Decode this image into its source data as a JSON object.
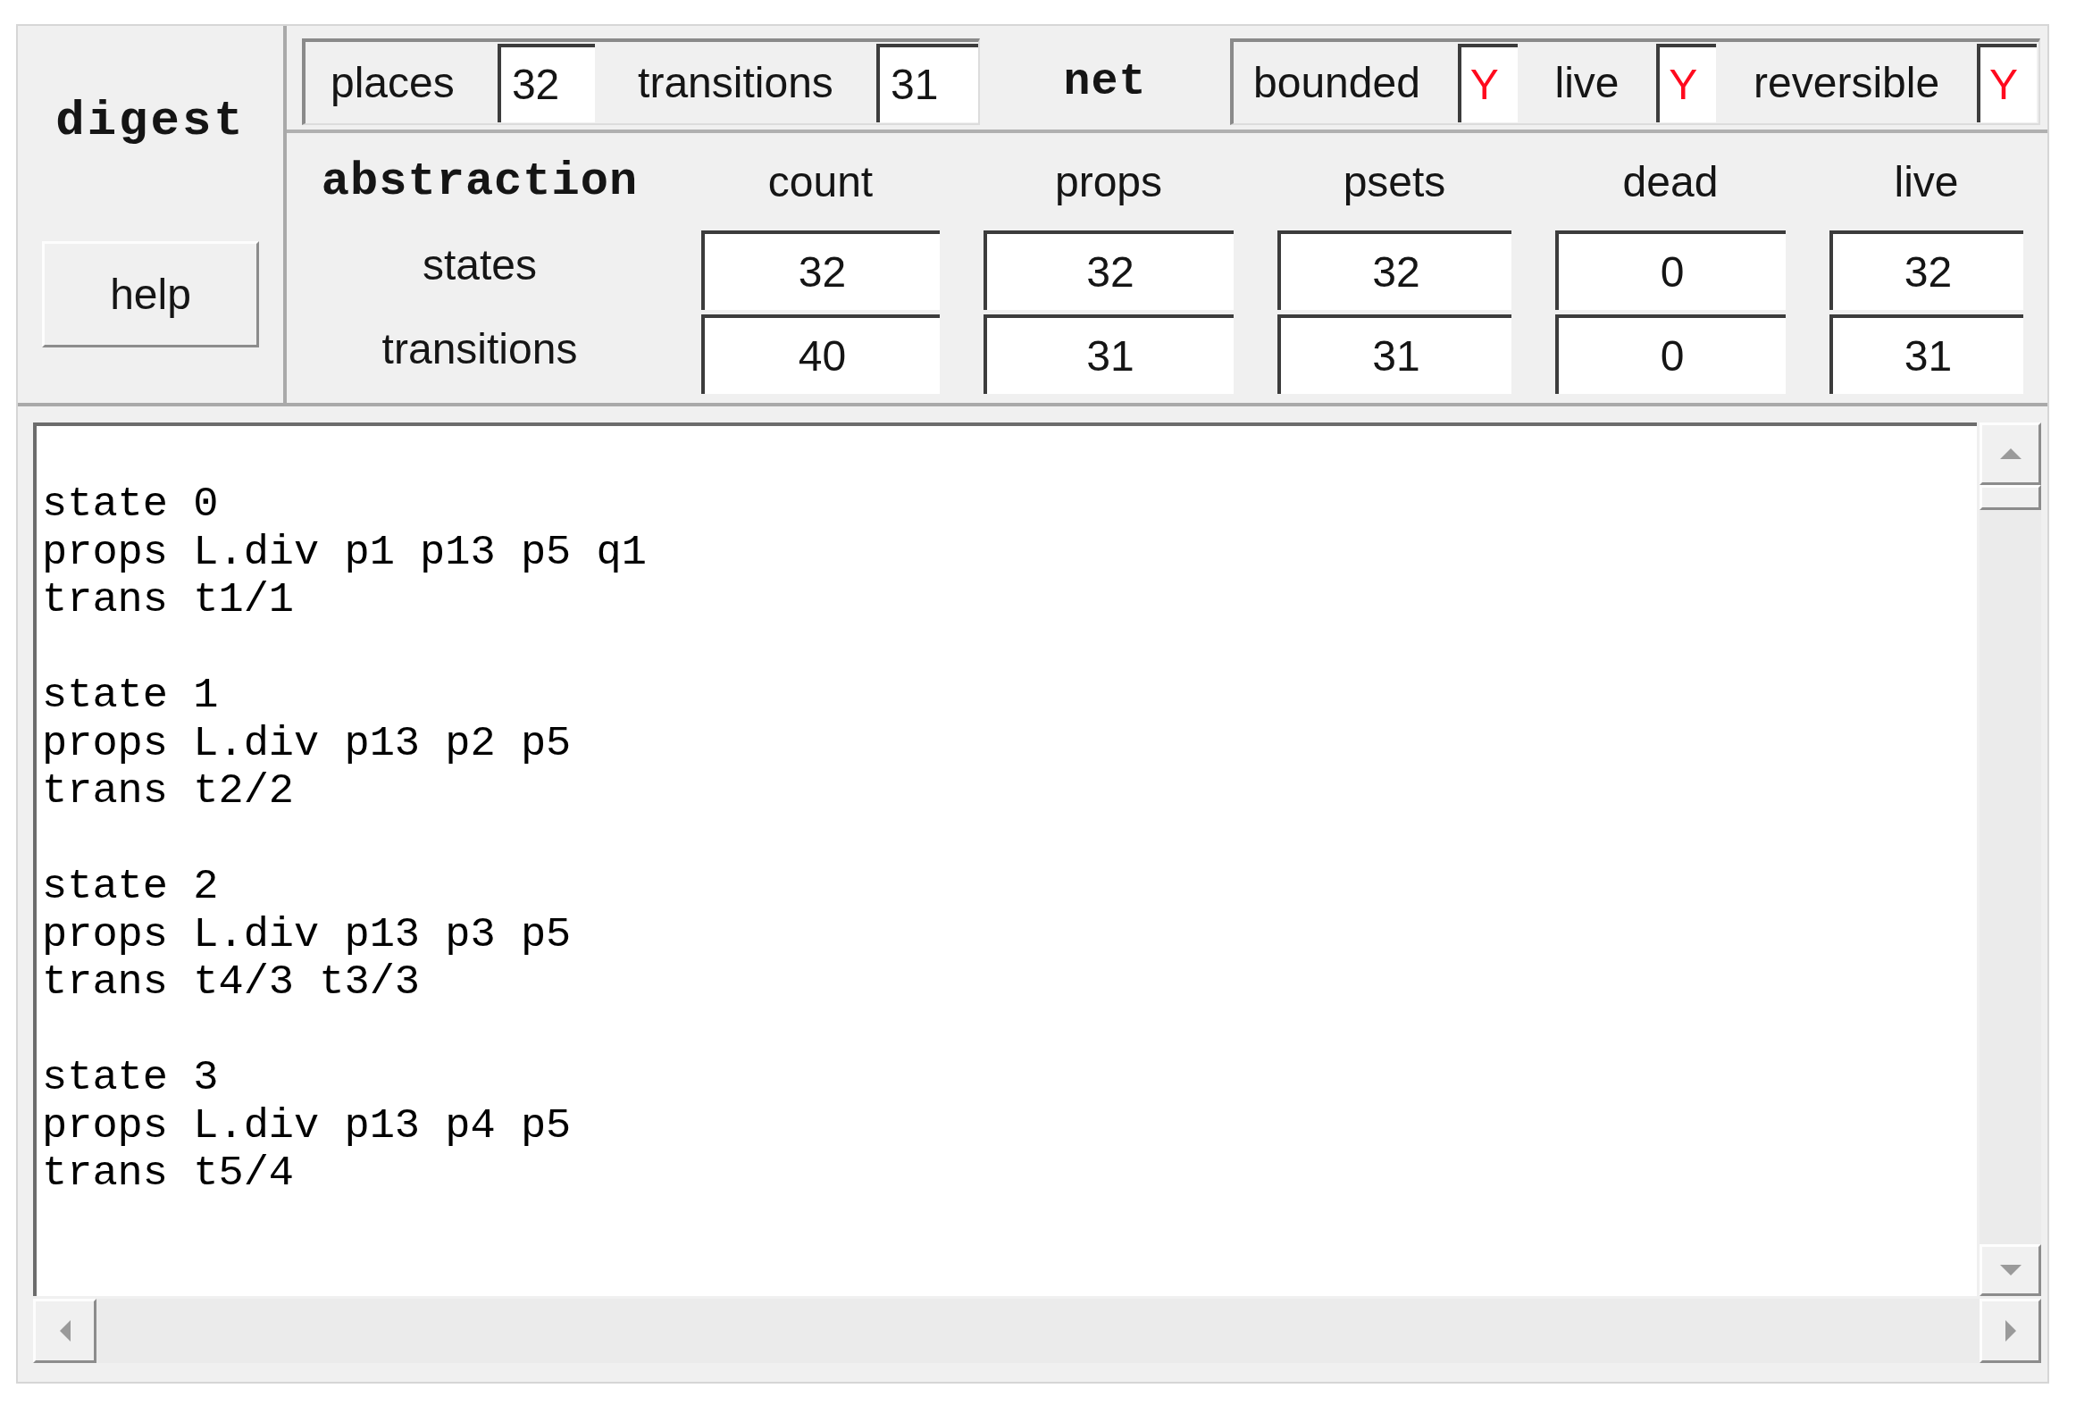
{
  "side_panel": {
    "title": "digest",
    "help_button": "help"
  },
  "net_summary": {
    "counts": [
      {
        "label": "places",
        "value": "32"
      },
      {
        "label": "transitions",
        "value": "31"
      }
    ],
    "title": "net",
    "properties": [
      {
        "label": "bounded",
        "value": "Y"
      },
      {
        "label": "live",
        "value": "Y"
      },
      {
        "label": "reversible",
        "value": "Y"
      }
    ]
  },
  "abstraction_table": {
    "title": "abstraction",
    "columns": [
      "count",
      "props",
      "psets",
      "dead",
      "live"
    ],
    "rows": [
      {
        "label": "states",
        "cells": [
          "32",
          "32",
          "32",
          "0",
          "32"
        ]
      },
      {
        "label": "transitions",
        "cells": [
          "40",
          "31",
          "31",
          "0",
          "31"
        ]
      }
    ]
  },
  "output": {
    "blocks": [
      {
        "lines": [
          "state 0",
          "props L.div p1 p13 p5 q1",
          "trans t1/1"
        ]
      },
      {
        "lines": [
          "state 1",
          "props L.div p13 p2 p5",
          "trans t2/2"
        ]
      },
      {
        "lines": [
          "state 2",
          "props L.div p13 p3 p5",
          "trans t4/3 t3/3"
        ]
      },
      {
        "lines": [
          "state 3",
          "props L.div p13 p4 p5",
          "trans t5/4"
        ]
      }
    ]
  }
}
